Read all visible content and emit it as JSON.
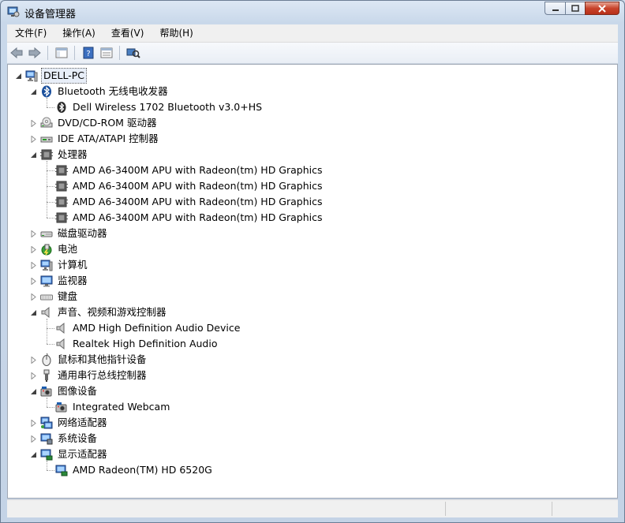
{
  "window": {
    "title": "设备管理器"
  },
  "menu": [
    "文件(F)",
    "操作(A)",
    "查看(V)",
    "帮助(H)"
  ],
  "tree": {
    "root": "DELL-PC",
    "categories": [
      {
        "label": "Bluetooth 无线电收发器",
        "icon": "bluetooth-icon",
        "expanded": true,
        "children": [
          "Dell Wireless 1702 Bluetooth v3.0+HS"
        ]
      },
      {
        "label": "DVD/CD-ROM 驱动器",
        "icon": "dvd-drive-icon",
        "expanded": false,
        "children": []
      },
      {
        "label": "IDE ATA/ATAPI 控制器",
        "icon": "ide-controller-icon",
        "expanded": false,
        "children": []
      },
      {
        "label": "处理器",
        "icon": "processor-icon",
        "expanded": true,
        "children": [
          "AMD A6-3400M APU with Radeon(tm) HD Graphics",
          "AMD A6-3400M APU with Radeon(tm) HD Graphics",
          "AMD A6-3400M APU with Radeon(tm) HD Graphics",
          "AMD A6-3400M APU with Radeon(tm) HD Graphics"
        ]
      },
      {
        "label": "磁盘驱动器",
        "icon": "disk-drive-icon",
        "expanded": false,
        "children": []
      },
      {
        "label": "电池",
        "icon": "battery-icon",
        "expanded": false,
        "children": []
      },
      {
        "label": "计算机",
        "icon": "computer-icon",
        "expanded": false,
        "children": []
      },
      {
        "label": "监视器",
        "icon": "monitor-icon",
        "expanded": false,
        "children": []
      },
      {
        "label": "键盘",
        "icon": "keyboard-icon",
        "expanded": false,
        "children": []
      },
      {
        "label": "声音、视频和游戏控制器",
        "icon": "speaker-icon",
        "expanded": true,
        "children": [
          "AMD High Definition Audio Device",
          "Realtek High Definition Audio"
        ]
      },
      {
        "label": "鼠标和其他指针设备",
        "icon": "mouse-icon",
        "expanded": false,
        "children": []
      },
      {
        "label": "通用串行总线控制器",
        "icon": "usb-icon",
        "expanded": false,
        "children": []
      },
      {
        "label": "图像设备",
        "icon": "camera-icon",
        "expanded": true,
        "children": [
          "Integrated Webcam"
        ]
      },
      {
        "label": "网络适配器",
        "icon": "network-adapter-icon",
        "expanded": false,
        "children": []
      },
      {
        "label": "系统设备",
        "icon": "system-device-icon",
        "expanded": false,
        "children": []
      },
      {
        "label": "显示适配器",
        "icon": "display-adapter-icon",
        "expanded": true,
        "children": [
          "AMD Radeon(TM) HD 6520G"
        ]
      }
    ]
  }
}
